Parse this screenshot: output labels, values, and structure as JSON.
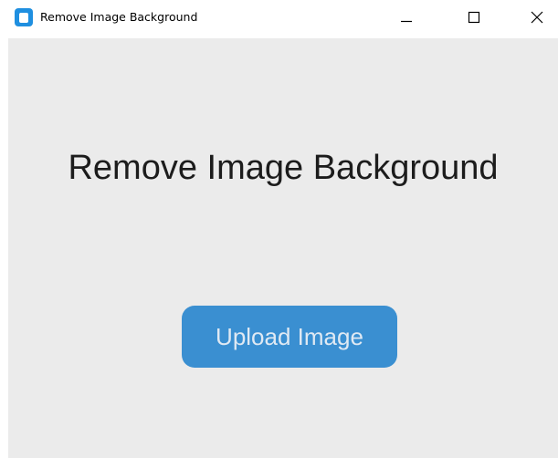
{
  "window": {
    "title": "Remove Image Background",
    "icon": "app-icon",
    "controls": [
      "minimize-icon",
      "maximize-icon",
      "close-icon"
    ]
  },
  "main": {
    "heading": "Remove Image Background",
    "upload_button_label": "Upload Image"
  },
  "colors": {
    "accent": "#3a8fd1",
    "app_icon": "#1f8fe0",
    "content_bg": "#ebebeb"
  }
}
